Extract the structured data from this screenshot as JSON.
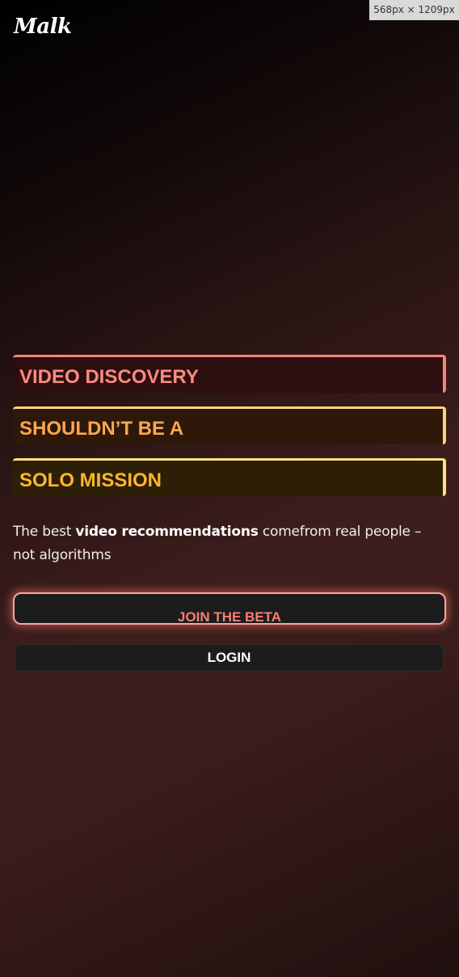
{
  "viewport_badge": "568px × 1209px",
  "brand": {
    "logo_text": "Malk"
  },
  "hero": {
    "lines": [
      "VIDEO DISCOVERY",
      "SHOULDN’T BE A",
      "SOLO MISSION"
    ],
    "tagline_prefix": "The best ",
    "tagline_bold": "video recommendations",
    "tagline_suffix": " comefrom real people – not algorithms"
  },
  "actions": {
    "join_label": "JOIN THE BETA",
    "login_label": "LOGIN"
  },
  "colors": {
    "line1": "#fc8a80",
    "line2": "#fca652",
    "line3": "#fcb531",
    "join_accent": "#f77e74"
  }
}
